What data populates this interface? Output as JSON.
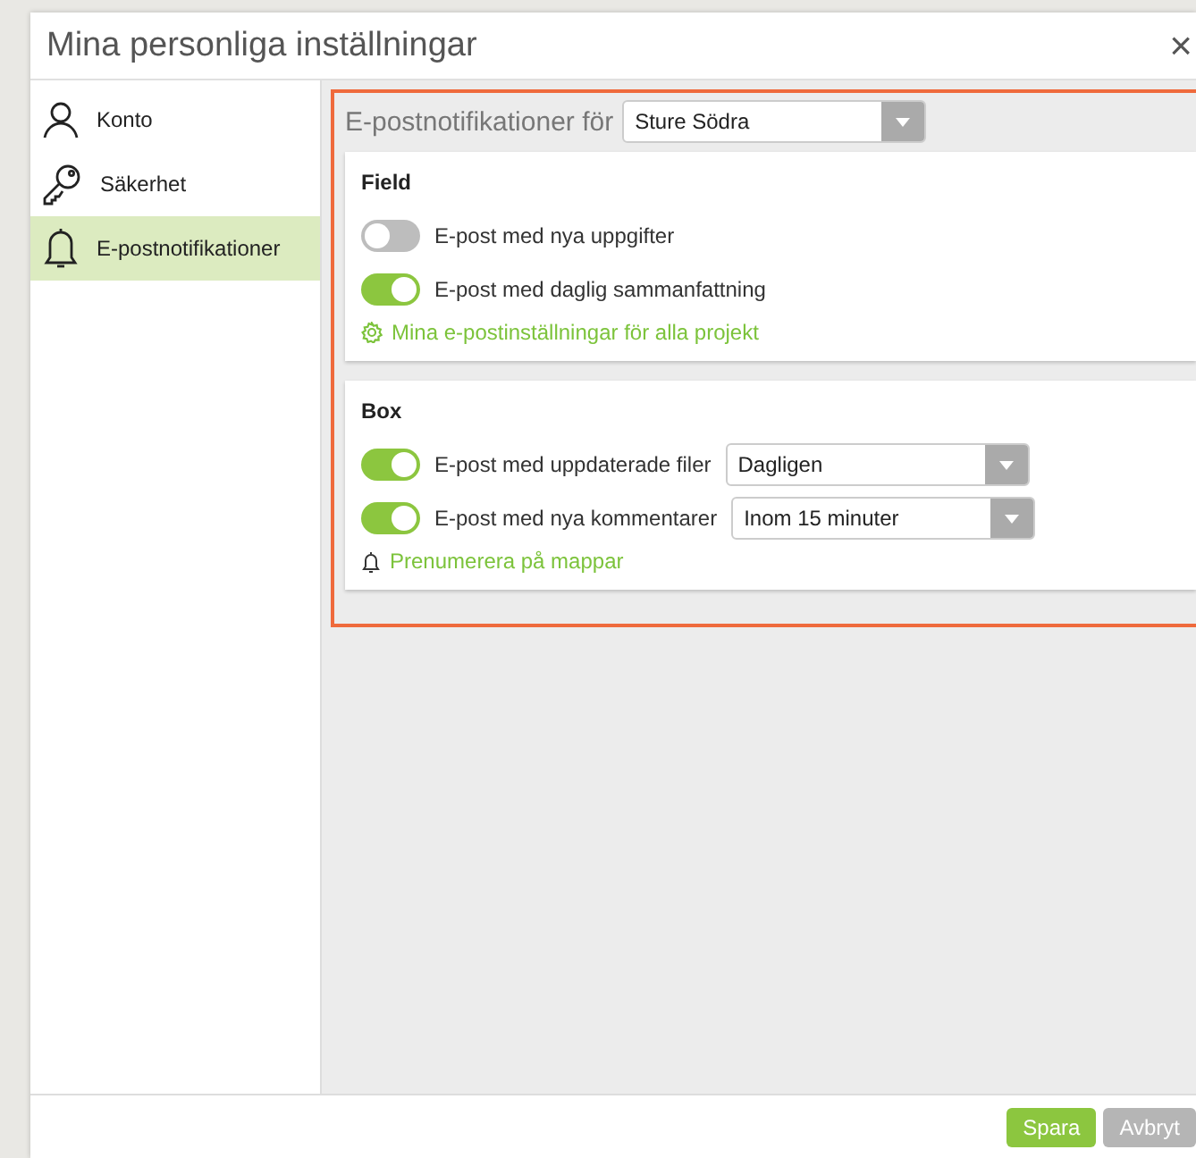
{
  "window": {
    "title": "Mina personliga inställningar",
    "close": "×"
  },
  "sidebar": {
    "items": [
      {
        "label": "Konto",
        "kind": "account",
        "selected": false
      },
      {
        "label": "Säkerhet",
        "kind": "security",
        "selected": false
      },
      {
        "label": "E-postnotifikationer",
        "kind": "notifications",
        "selected": true
      }
    ]
  },
  "header": {
    "label": "E-postnotifikationer för",
    "project": "Sture Södra"
  },
  "sections": [
    {
      "title": "Field",
      "rows": [
        {
          "label": "E-post med nya uppgifter",
          "on": false
        },
        {
          "label": "E-post med daglig sammanfattning",
          "on": true
        }
      ],
      "link": {
        "label": "Mina e-postinställningar för alla projekt",
        "kind": "settings"
      }
    },
    {
      "title": "Box",
      "rows": [
        {
          "label": "E-post med uppdaterade filer",
          "on": true,
          "select": "Dagligen"
        },
        {
          "label": "E-post med nya kommentarer",
          "on": true,
          "select": "Inom 15 minuter"
        }
      ],
      "link": {
        "label": "Prenumerera på mappar",
        "kind": "subscribe"
      }
    }
  ],
  "buttons": [
    {
      "label": "Spara",
      "kind": "primary"
    },
    {
      "label": "Avbryt",
      "kind": "secondary"
    }
  ]
}
